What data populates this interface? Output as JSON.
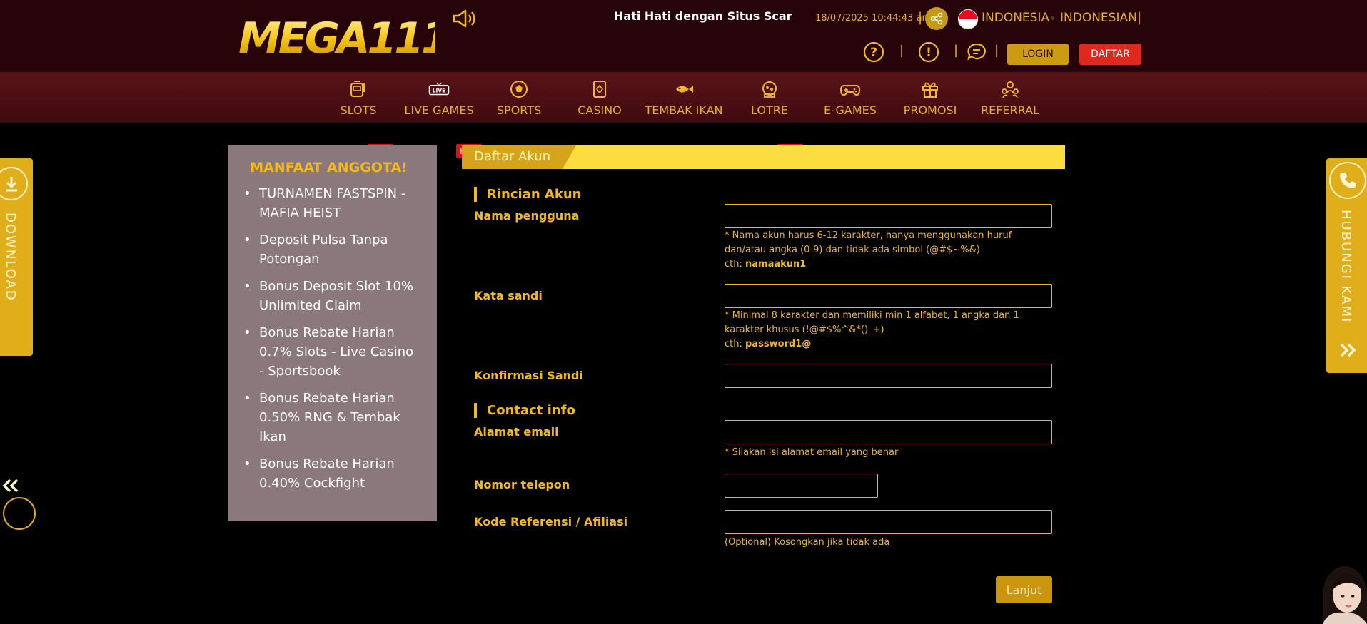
{
  "header": {
    "logo_text": "MEGA111",
    "marquee": "Hati Hati dengan Situs Scar",
    "datetime": "18/07/2025 10:44:43 am",
    "country": "INDONESIA",
    "language": "INDONESIAN",
    "login_label": "LOGIN",
    "register_label": "DAFTAR"
  },
  "nav": {
    "items": [
      {
        "label": "SLOTS",
        "icon": "slot-machine-icon",
        "hot": true
      },
      {
        "label": "LIVE GAMES",
        "icon": "live-icon",
        "hot": true
      },
      {
        "label": "SPORTS",
        "icon": "soccer-ball-icon",
        "hot": false
      },
      {
        "label": "CASINO",
        "icon": "cards-icon",
        "hot": false
      },
      {
        "label": "TEMBAK IKAN",
        "icon": "fish-icon",
        "hot": false
      },
      {
        "label": "LOTRE",
        "icon": "lottery-icon",
        "hot": true
      },
      {
        "label": "E-GAMES",
        "icon": "gamepad-icon",
        "hot": false
      },
      {
        "label": "PROMOSI",
        "icon": "gift-icon",
        "hot": false
      },
      {
        "label": "REFERRAL",
        "icon": "referral-icon",
        "hot": false
      }
    ],
    "hot_label": "HOT"
  },
  "benefits": {
    "title": "MANFAAT ANGGOTA!",
    "items": [
      "TURNAMEN FASTSPIN - MAFIA HEIST",
      "Deposit Pulsa Tanpa Potongan",
      "Bonus Deposit Slot 10% Unlimited Claim",
      "Bonus Rebate Harian 0.7% Slots - Live Casino - Sportsbook",
      "Bonus Rebate Harian 0.50% RNG & Tembak Ikan",
      "Bonus Rebate Harian 0.40% Cockfight"
    ]
  },
  "form": {
    "header": "Daftar Akun",
    "section_account": "Rincian Akun",
    "section_contact": "Contact info",
    "username_label": "Nama pengguna",
    "username_hint": "* Nama akun harus 6-12 karakter, hanya menggunakan huruf dan/atau angka (0-9) dan tidak ada simbol (@#$~%&)",
    "username_example_prefix": "cth: ",
    "username_example": "namaakun1",
    "password_label": "Kata sandi",
    "password_hint": "* Minimal 8 karakter dan memiliki min 1 alfabet, 1 angka dan 1 karakter khusus (!@#$%^&*()_+)",
    "password_example_prefix": "cth: ",
    "password_example": "password1@",
    "confirm_label": "Konfirmasi Sandi",
    "email_label": "Alamat email",
    "email_hint": "* Silakan isi alamat email yang benar",
    "phone_label": "Nomor telepon",
    "referral_label": "Kode Referensi / Afiliasi",
    "referral_hint": "(Optional) Kosongkan jika tidak ada",
    "submit_label": "Lanjut"
  },
  "side_tabs": {
    "download": "DOWNLOAD",
    "contact": "HUBUNGI KAMI"
  },
  "colors": {
    "gold": "#f2b81f",
    "header_bg": "#260409",
    "nav_bg": "#4a0e13",
    "register_red": "#e0291e"
  }
}
